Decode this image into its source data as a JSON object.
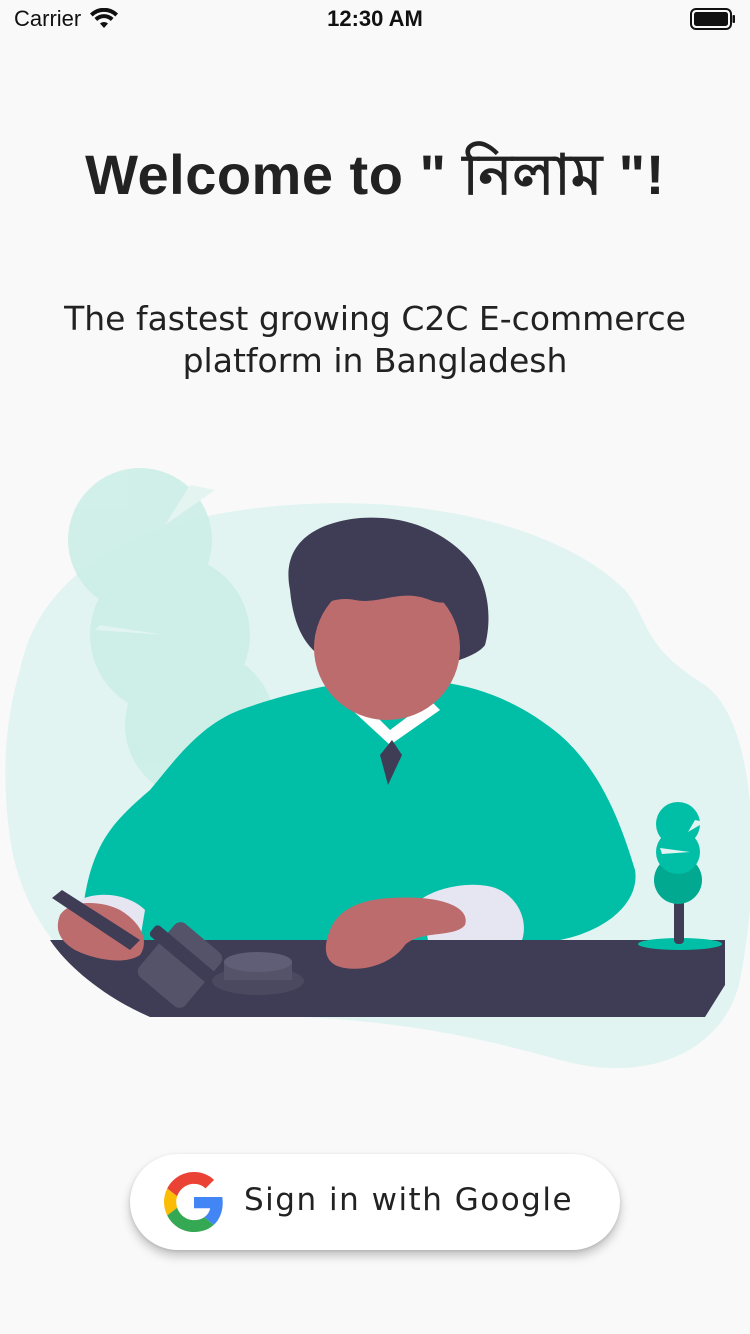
{
  "status_bar": {
    "carrier": "Carrier",
    "time": "12:30 AM",
    "wifi_icon": "wifi-icon",
    "battery_icon": "battery-full-icon"
  },
  "welcome": {
    "title": "Welcome to \" নিলাম \"!"
  },
  "subtitle": "The fastest growing C2C E-commerce platform in Bangladesh",
  "illustration": {
    "name": "auction-judge-illustration"
  },
  "sign_in": {
    "label": "Sign in with Google",
    "icon": "google-logo-icon"
  },
  "colors": {
    "background": "#f9f9f9",
    "accent": "#00bfa6",
    "text": "#222222"
  }
}
